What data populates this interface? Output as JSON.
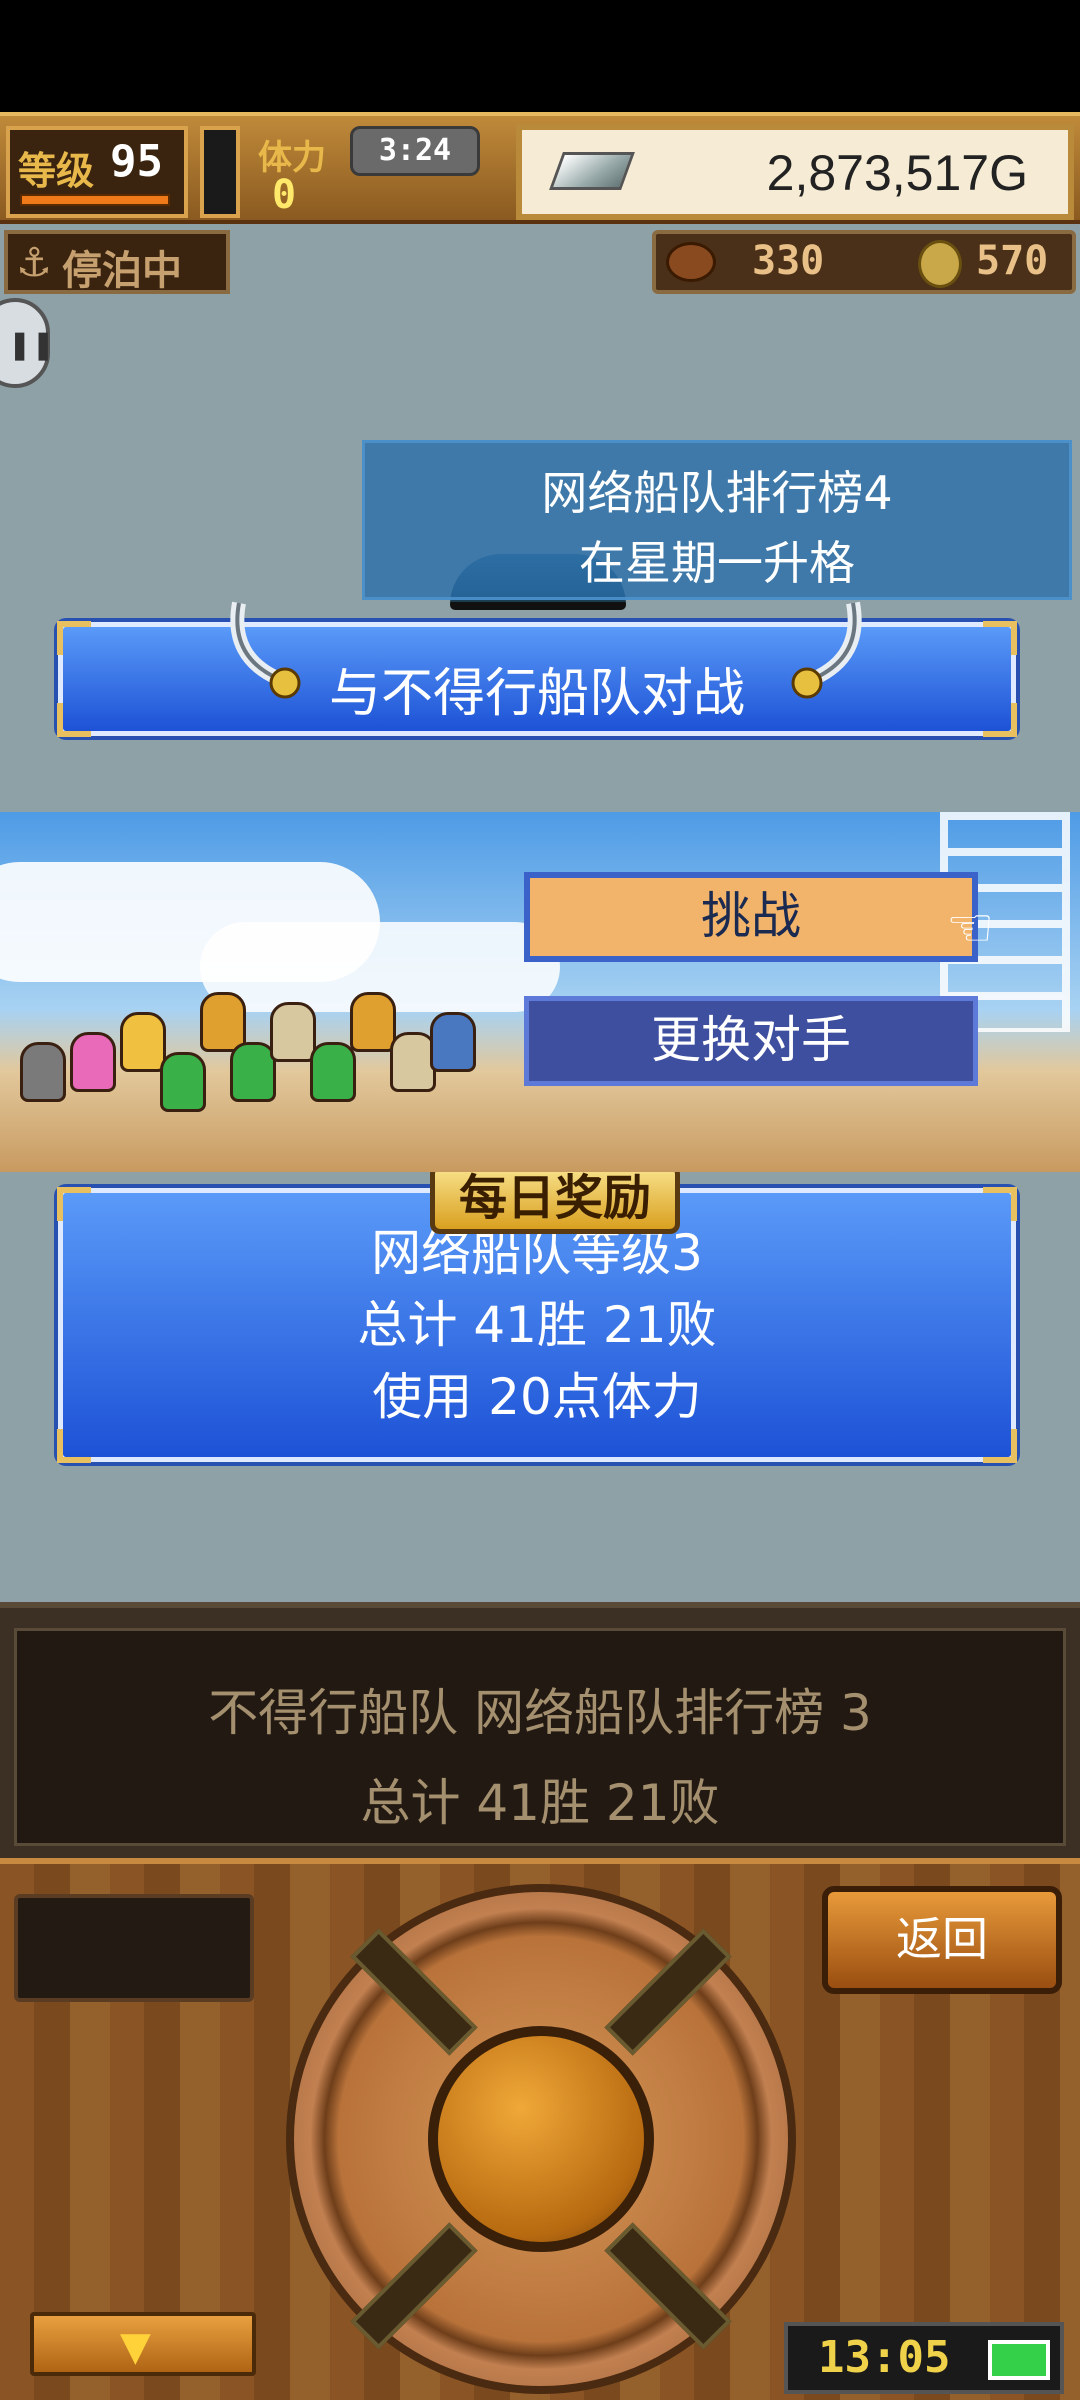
{
  "hud": {
    "level_label": "等级",
    "level_value": "95",
    "stamina_label": "体力",
    "stamina_value": "0",
    "stamina_timer": "3:24",
    "money": "2,873,517G"
  },
  "status": {
    "docked_label": "停泊中",
    "resource1": "330",
    "resource2": "570"
  },
  "rank_info": {
    "line1": "网络船队排行榜4",
    "line2": "在星期一升格"
  },
  "battle_button_label": "与不得行船队对战",
  "deck": {
    "challenge_label": "挑战",
    "change_label": "更换对手"
  },
  "daily_reward": {
    "tag": "每日奖励",
    "lines": [
      "网络船队等级3",
      "总计 41胜 21败",
      "使用 20点体力"
    ]
  },
  "info_panel": {
    "line1": "不得行船队  网络船队排行榜  3",
    "line2": "总计 41胜 21败"
  },
  "controls": {
    "back_label": "返回",
    "down_icon": "▼",
    "clock": "13:05"
  },
  "colors": {
    "button_blue": "#2f6ae8",
    "challenge_orange": "#f2b46a",
    "wood": "#8a5424"
  }
}
